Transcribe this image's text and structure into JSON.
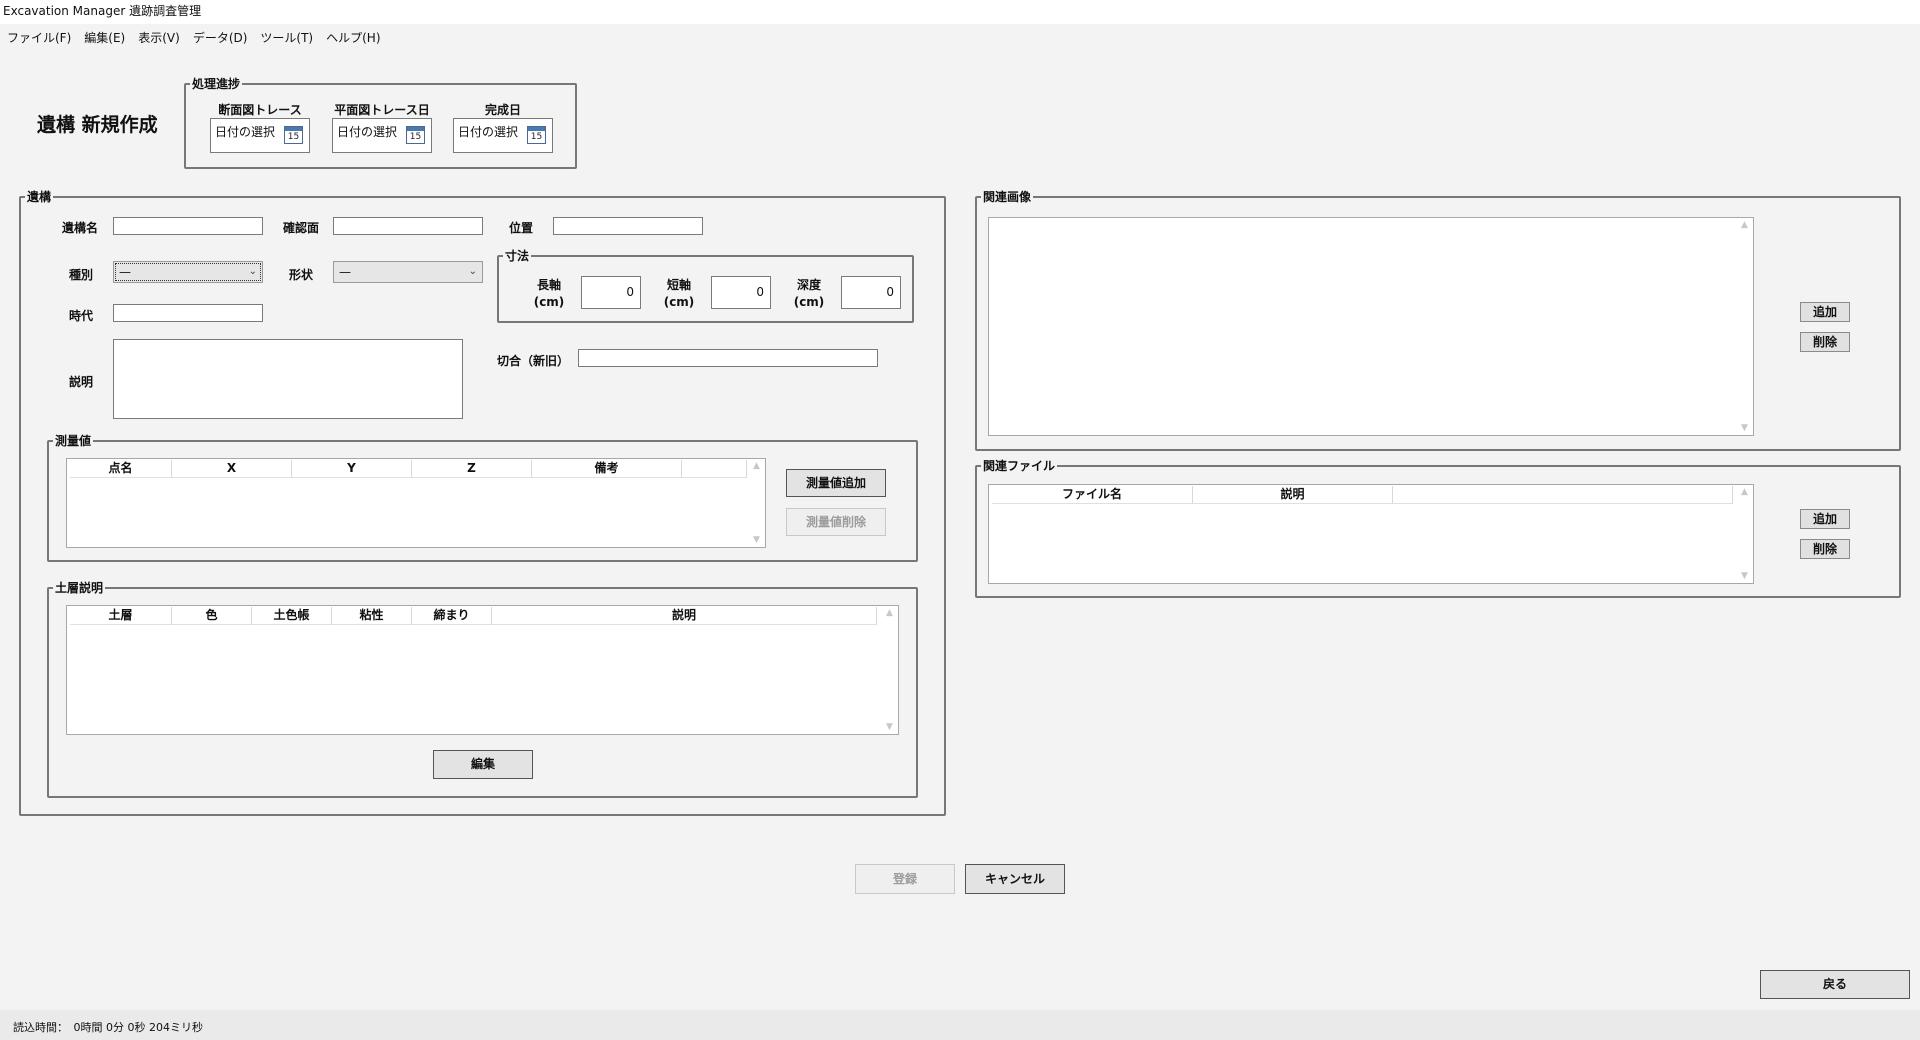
{
  "window": {
    "title": "Excavation Manager 遺跡調査管理"
  },
  "menu": [
    {
      "label": "ファイル(F)"
    },
    {
      "label": "編集(E)"
    },
    {
      "label": "表示(V)"
    },
    {
      "label": "データ(D)"
    },
    {
      "label": "ツール(T)"
    },
    {
      "label": "ヘルプ(H)"
    }
  ],
  "page_title": "遺構 新規作成",
  "progress": {
    "legend": "処理進捗",
    "items": [
      {
        "label": "断面図トレース",
        "value": "日付の選択",
        "icon_text": "15"
      },
      {
        "label": "平面図トレース日",
        "value": "日付の選択",
        "icon_text": "15"
      },
      {
        "label": "完成日",
        "value": "日付の選択",
        "icon_text": "15"
      }
    ]
  },
  "feature": {
    "legend": "遺構",
    "name_label": "遺構名",
    "name_value": "",
    "surface_label": "確認面",
    "surface_value": "",
    "position_label": "位置",
    "position_value": "",
    "type_label": "種別",
    "type_value": "—",
    "shape_label": "形状",
    "shape_value": "—",
    "era_label": "時代",
    "era_value": "",
    "desc_label": "説明",
    "desc_value": "",
    "cut_label": "切合（新旧）",
    "cut_value": "",
    "dims": {
      "legend": "寸法",
      "long_label_1": "長軸",
      "long_label_2": "(cm)",
      "long_value": "0",
      "short_label_1": "短軸",
      "short_label_2": "(cm)",
      "short_value": "0",
      "depth_label_1": "深度",
      "depth_label_2": "(cm)",
      "depth_value": "0"
    }
  },
  "survey": {
    "legend": "測量値",
    "columns": [
      "点名",
      "X",
      "Y",
      "Z",
      "備考"
    ],
    "rows": [],
    "add_button": "測量値追加",
    "delete_button": "測量値削除"
  },
  "soil": {
    "legend": "土層説明",
    "columns": [
      "土層",
      "色",
      "土色帳",
      "粘性",
      "締まり",
      "説明"
    ],
    "rows": [],
    "edit_button": "編集"
  },
  "images": {
    "legend": "関連画像",
    "add_button": "追加",
    "delete_button": "削除"
  },
  "files": {
    "legend": "関連ファイル",
    "columns": [
      "ファイル名",
      "説明"
    ],
    "rows": [],
    "add_button": "追加",
    "delete_button": "削除"
  },
  "actions": {
    "register": "登録",
    "cancel": "キャンセル",
    "back": "戻る"
  },
  "status": {
    "text": "読込時間：　0時間 0分 0秒 204ミリ秒"
  },
  "colors": {
    "window_bg": "#f3f3f3",
    "group_border": "#777777",
    "input_border": "#7a7a7a"
  }
}
